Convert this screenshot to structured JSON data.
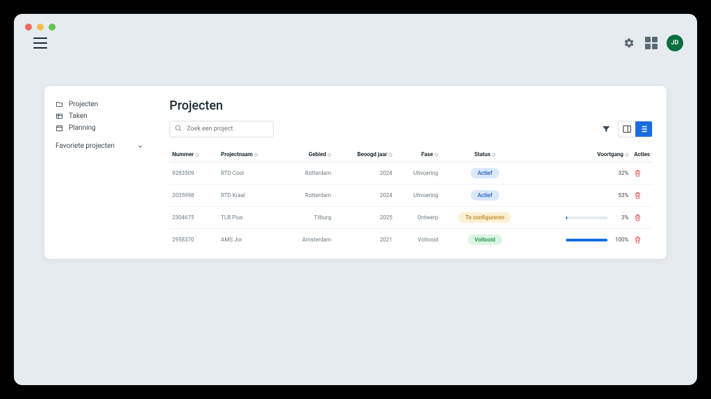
{
  "header": {
    "avatar_initials": "JD"
  },
  "sidebar": {
    "items": [
      {
        "label": "Projecten",
        "icon": "folder"
      },
      {
        "label": "Taken",
        "icon": "table"
      },
      {
        "label": "Planning",
        "icon": "calendar"
      }
    ],
    "favorites_label": "Favoriete projecten"
  },
  "page": {
    "title": "Projecten",
    "search_placeholder": "Zoek een project"
  },
  "table": {
    "headers": {
      "nummer": "Nummer",
      "projectnaam": "Projectnaam",
      "gebied": "Gebied",
      "jaar": "Beoogd jaar",
      "fase": "Fase",
      "status": "Status",
      "voortgang": "Voortgang",
      "acties": "Acties"
    },
    "rows": [
      {
        "nummer": "9283509",
        "naam": "RTD Cool",
        "gebied": "Rotterdam",
        "jaar": "2024",
        "fase": "Uitvoering",
        "status": "Actief",
        "status_class": "actief",
        "progress": 32
      },
      {
        "nummer": "2035998",
        "naam": "RTD Kraal",
        "gebied": "Rotterdam",
        "jaar": "2024",
        "fase": "Uitvoering",
        "status": "Actief",
        "status_class": "actief",
        "progress": 53
      },
      {
        "nummer": "2304675",
        "naam": "TLB Pius",
        "gebied": "Tilburg",
        "jaar": "2025",
        "fase": "Ontwerp",
        "status": "Te configureren",
        "status_class": "config",
        "progress": 3
      },
      {
        "nummer": "2958370",
        "naam": "AMS Jor",
        "gebied": "Amsterdam",
        "jaar": "2021",
        "fase": "Voltooid",
        "status": "Voltooid",
        "status_class": "voltooid",
        "progress": 100
      }
    ]
  }
}
